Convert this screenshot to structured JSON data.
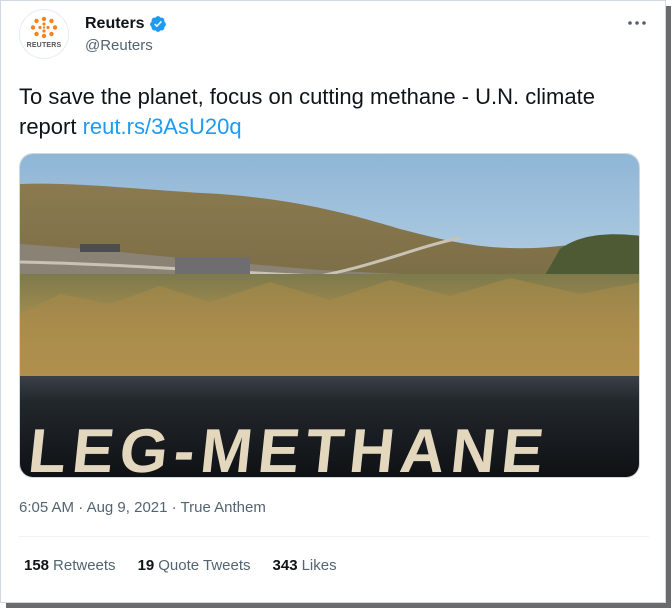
{
  "author": {
    "display_name": "Reuters",
    "handle": "@Reuters",
    "avatar_text": "REUTERS",
    "verified": true
  },
  "tweet": {
    "text": "To save the planet, focus on cutting methane - U.N. climate report",
    "link": "reut.rs/3AsU20q",
    "image_text": "LEG-METHANE"
  },
  "meta": {
    "time": "6:05 AM",
    "date": "Aug 9, 2021",
    "source": "True Anthem",
    "dot": "·"
  },
  "stats": {
    "retweets_count": "158",
    "retweets_label": "Retweets",
    "quote_count": "19",
    "quote_label": "Quote Tweets",
    "likes_count": "343",
    "likes_label": "Likes"
  },
  "colors": {
    "link": "#1d9bf0",
    "verified": "#1d9bf0",
    "logo_orange": "#f58220"
  },
  "icons": [
    "verified-badge-icon",
    "more-options-icon",
    "reuters-logo-icon"
  ]
}
